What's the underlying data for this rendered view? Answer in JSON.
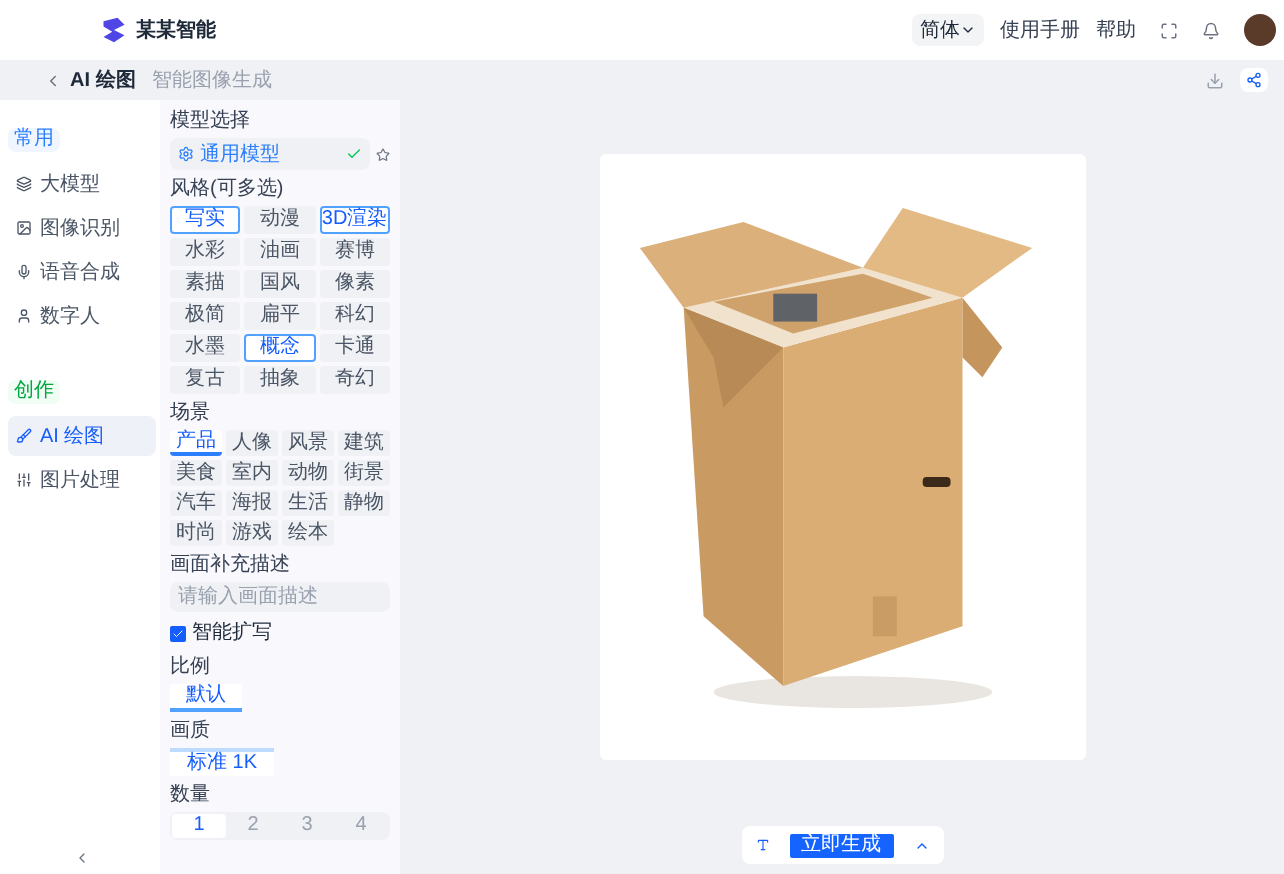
{
  "header": {
    "brand": "某某智能",
    "language": "简体",
    "links": [
      "使用手册",
      "帮助"
    ]
  },
  "subheader": {
    "title": "AI 绘图",
    "subtitle": "智能图像生成"
  },
  "sidebar": {
    "groups": [
      {
        "badge": "常用",
        "items": [
          {
            "label": "大模型",
            "selected": false
          },
          {
            "label": "图像识别",
            "selected": false
          },
          {
            "label": "语音合成",
            "selected": false
          },
          {
            "label": "数字人",
            "selected": false
          }
        ]
      },
      {
        "badge": "创作",
        "items": [
          {
            "label": "AI 绘图",
            "selected": true
          },
          {
            "label": "图片处理",
            "selected": false
          }
        ]
      }
    ]
  },
  "panel": {
    "model_label": "模型选择",
    "model_value": "通用模型",
    "style_label": "风格(可多选)",
    "styles": [
      {
        "label": "写实",
        "selected": true
      },
      {
        "label": "动漫",
        "selected": false
      },
      {
        "label": "3D渲染",
        "selected": true
      },
      {
        "label": "水彩",
        "selected": false
      },
      {
        "label": "油画",
        "selected": false
      },
      {
        "label": "赛博",
        "selected": false
      },
      {
        "label": "素描",
        "selected": false
      },
      {
        "label": "国风",
        "selected": false
      },
      {
        "label": "像素",
        "selected": false
      },
      {
        "label": "极简",
        "selected": false
      },
      {
        "label": "扁平",
        "selected": false
      },
      {
        "label": "科幻",
        "selected": false
      },
      {
        "label": "水墨",
        "selected": false
      },
      {
        "label": "概念",
        "selected": true
      },
      {
        "label": "卡通",
        "selected": false
      },
      {
        "label": "复古",
        "selected": false
      },
      {
        "label": "抽象",
        "selected": false
      },
      {
        "label": "奇幻",
        "selected": false
      }
    ],
    "scene_label": "场景",
    "scenes": [
      {
        "label": "产品",
        "selected": true
      },
      {
        "label": "人像",
        "selected": false
      },
      {
        "label": "风景",
        "selected": false
      },
      {
        "label": "建筑",
        "selected": false
      },
      {
        "label": "美食",
        "selected": false
      },
      {
        "label": "室内",
        "selected": false
      },
      {
        "label": "动物",
        "selected": false
      },
      {
        "label": "街景",
        "selected": false
      },
      {
        "label": "汽车",
        "selected": false
      },
      {
        "label": "海报",
        "selected": false
      },
      {
        "label": "生活",
        "selected": false
      },
      {
        "label": "静物",
        "selected": false
      },
      {
        "label": "时尚",
        "selected": false
      },
      {
        "label": "游戏",
        "selected": false
      },
      {
        "label": "绘本",
        "selected": false
      }
    ],
    "prompt_label": "画面补充描述",
    "prompt_placeholder": "请输入画面描述",
    "expand": {
      "label": "智能扩写",
      "checked": true
    },
    "ratio_label": "比例",
    "ratio_tabs": [
      {
        "label": "默认",
        "selected": true
      }
    ],
    "quality_label": "画质",
    "quality_value": "标准 1K",
    "count_label": "数量",
    "counts": [
      {
        "label": "1",
        "selected": true
      },
      {
        "label": "2",
        "selected": false
      },
      {
        "label": "3",
        "selected": false
      },
      {
        "label": "4",
        "selected": false
      }
    ]
  },
  "toolbar": {
    "generate": "立即生成"
  }
}
